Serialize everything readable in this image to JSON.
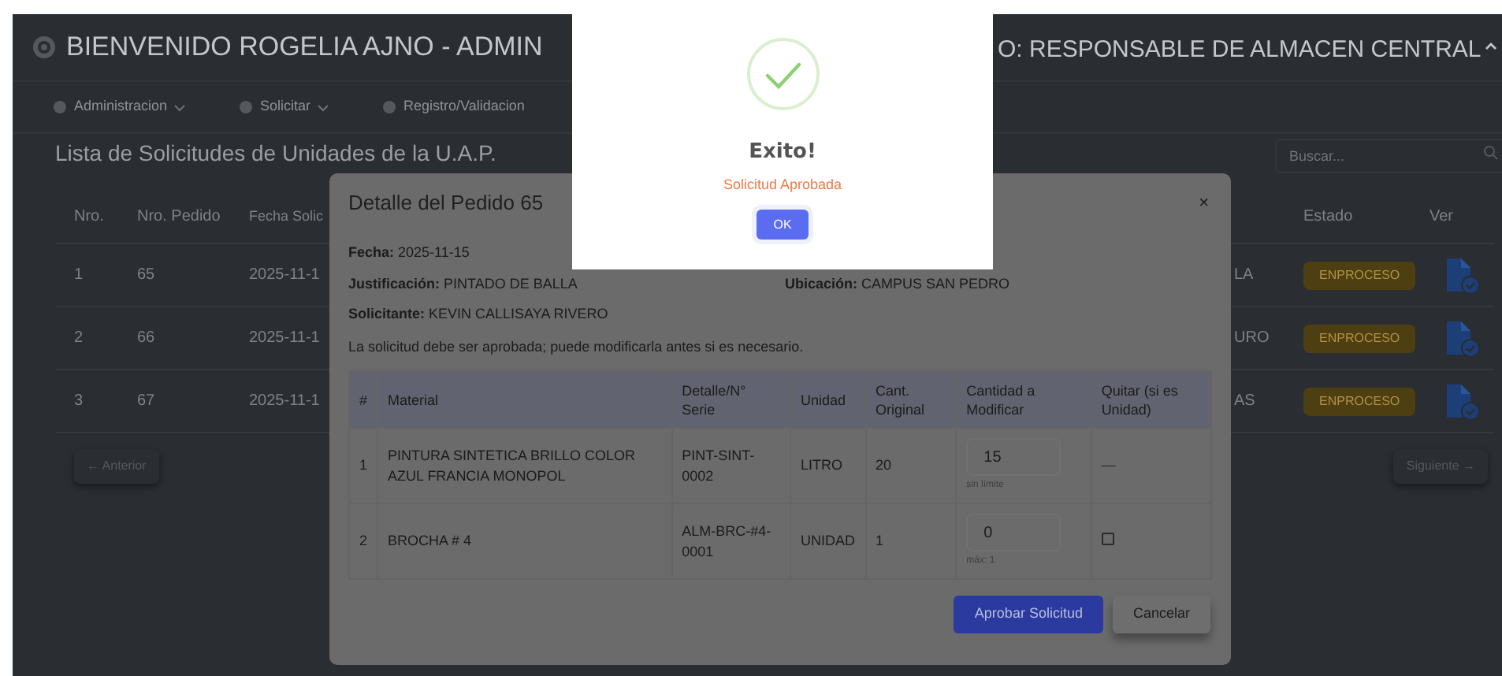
{
  "header": {
    "title": "BIENVENIDO ROGELIA AJNO - ADMIN",
    "role_text": "O: RESPONSABLE DE ALMACEN CENTRAL"
  },
  "nav": [
    {
      "label": "Administracion",
      "dropdown": true
    },
    {
      "label": "Solicitar",
      "dropdown": true
    },
    {
      "label": "Registro/Validacion",
      "dropdown": false
    }
  ],
  "page_title": "Lista de Solicitudes de Unidades de la U.A.P.",
  "search": {
    "placeholder": "Buscar..."
  },
  "list_table": {
    "columns": [
      "Nro.",
      "Nro. Pedido",
      "Fecha Solic",
      "Estado",
      "Ver"
    ],
    "rows": [
      {
        "nro": "1",
        "pedido": "65",
        "fecha": "2025-11-1",
        "column_4": "LA",
        "estado": "ENPROCESO"
      },
      {
        "nro": "2",
        "pedido": "66",
        "fecha": "2025-11-1",
        "column_4": "URO",
        "estado": "ENPROCESO"
      },
      {
        "nro": "3",
        "pedido": "67",
        "fecha": "2025-11-1",
        "column_4": "AS",
        "estado": "ENPROCESO"
      }
    ]
  },
  "pagination": {
    "prev": "← Anterior",
    "next": "Siguiente →"
  },
  "modal": {
    "title": "Detalle del Pedido 65",
    "close": "×",
    "fecha": {
      "label": "Fecha:",
      "value": "2025-11-15"
    },
    "justificacion": {
      "label": "Justificación:",
      "value": "PINTADO DE BALLA"
    },
    "ubicacion": {
      "label": "Ubicación:",
      "value": "CAMPUS SAN PEDRO"
    },
    "solicitante": {
      "label": "Solicitante:",
      "value": "KEVIN CALLISAYA RIVERO"
    },
    "note": "La solicitud debe ser aprobada; puede modificarla antes si es necesario.",
    "table": {
      "columns": [
        "#",
        "Material",
        "Detalle/N° Serie",
        "Unidad",
        "Cant. Original",
        "Cantidad a Modificar",
        "Quitar (si es Unidad)"
      ],
      "rows": [
        {
          "num": "1",
          "material": "PINTURA SINTETICA BRILLO COLOR AZUL FRANCIA MONOPOL",
          "serie": "PINT-SINT-0002",
          "unidad": "LITRO",
          "original": "20",
          "cantidad": "15",
          "hint": "sin límite",
          "remove": {
            "kind": "dash",
            "text": "—"
          }
        },
        {
          "num": "2",
          "material": "BROCHA # 4",
          "serie": "ALM-BRC-#4-0001",
          "unidad": "UNIDAD",
          "original": "1",
          "cantidad": "0",
          "hint": "máx: 1",
          "remove": {
            "kind": "checkbox",
            "checked": false
          }
        }
      ]
    },
    "buttons": {
      "approve": "Aprobar Solicitud",
      "cancel": "Cancelar"
    }
  },
  "alert": {
    "title": "Exito!",
    "message": "Solicitud Aprobada",
    "button": "OK"
  }
}
